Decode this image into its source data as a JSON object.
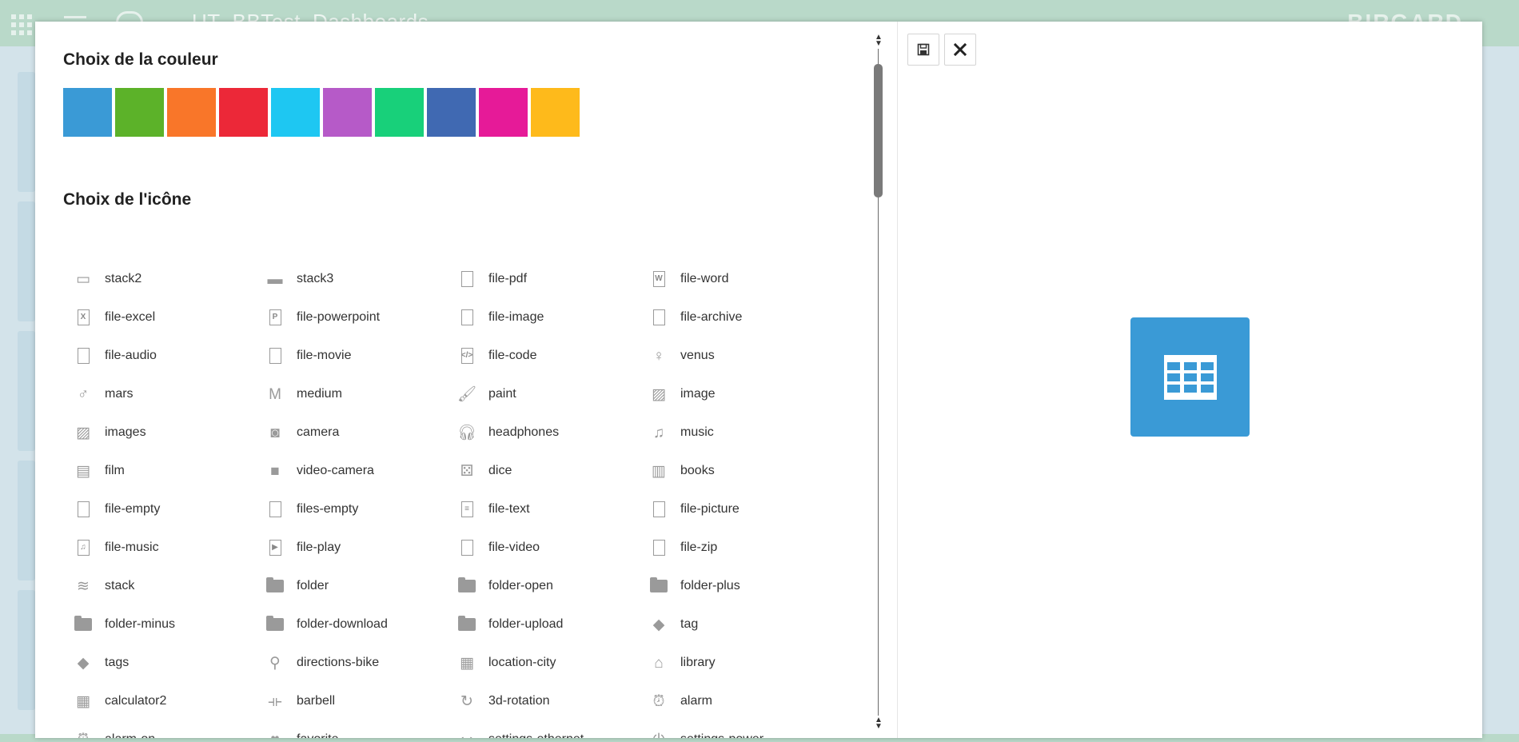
{
  "background": {
    "title": "UT_BBTest_Dashboards",
    "logo": "BIRGARD"
  },
  "color_section": {
    "title": "Choix de la couleur",
    "swatches": [
      "#3a9ad6",
      "#5cb229",
      "#f97629",
      "#ec2838",
      "#1ec7f2",
      "#b65ac8",
      "#18d07a",
      "#4069b2",
      "#e61a98",
      "#feba1b"
    ]
  },
  "icon_section": {
    "title": "Choix de l'icône",
    "icons": [
      {
        "name": "stack2"
      },
      {
        "name": "stack3"
      },
      {
        "name": "file-pdf"
      },
      {
        "name": "file-word"
      },
      {
        "name": "file-excel"
      },
      {
        "name": "file-powerpoint"
      },
      {
        "name": "file-image"
      },
      {
        "name": "file-archive"
      },
      {
        "name": "file-audio"
      },
      {
        "name": "file-movie"
      },
      {
        "name": "file-code"
      },
      {
        "name": "venus"
      },
      {
        "name": "mars"
      },
      {
        "name": "medium"
      },
      {
        "name": "paint"
      },
      {
        "name": "image"
      },
      {
        "name": "images"
      },
      {
        "name": "camera"
      },
      {
        "name": "headphones"
      },
      {
        "name": "music"
      },
      {
        "name": "film"
      },
      {
        "name": "video-camera"
      },
      {
        "name": "dice"
      },
      {
        "name": "books"
      },
      {
        "name": "file-empty"
      },
      {
        "name": "files-empty"
      },
      {
        "name": "file-text"
      },
      {
        "name": "file-picture"
      },
      {
        "name": "file-music"
      },
      {
        "name": "file-play"
      },
      {
        "name": "file-video"
      },
      {
        "name": "file-zip"
      },
      {
        "name": "stack"
      },
      {
        "name": "folder"
      },
      {
        "name": "folder-open"
      },
      {
        "name": "folder-plus"
      },
      {
        "name": "folder-minus"
      },
      {
        "name": "folder-download"
      },
      {
        "name": "folder-upload"
      },
      {
        "name": "tag"
      },
      {
        "name": "tags"
      },
      {
        "name": "directions-bike"
      },
      {
        "name": "location-city"
      },
      {
        "name": "library"
      },
      {
        "name": "calculator2"
      },
      {
        "name": "barbell"
      },
      {
        "name": "3d-rotation"
      },
      {
        "name": "alarm"
      },
      {
        "name": "alarm-on"
      },
      {
        "name": "favorite"
      },
      {
        "name": "settings-ethernet"
      },
      {
        "name": "settings-power"
      }
    ]
  },
  "toolbar": {
    "save_icon": "save-icon",
    "close_icon": "close-icon"
  },
  "preview": {
    "color": "#3a9ad6",
    "icon": "table-icon"
  }
}
